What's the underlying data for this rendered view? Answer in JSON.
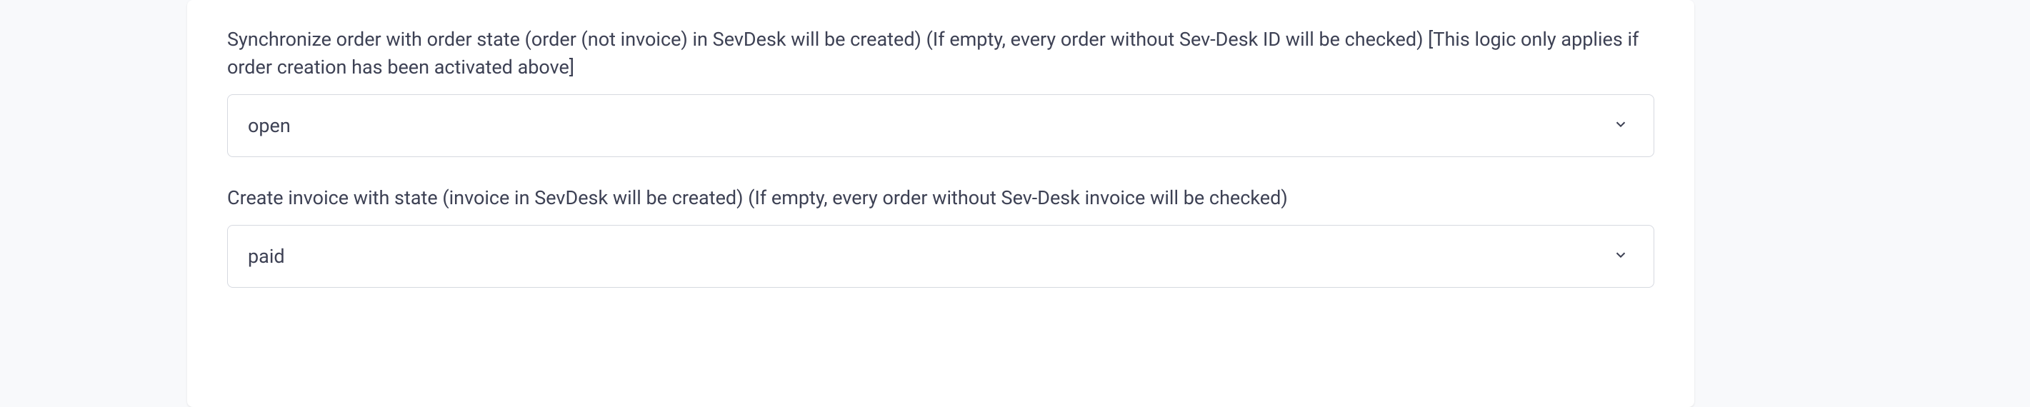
{
  "form": {
    "fields": [
      {
        "label": "Synchronize order with order state (order (not invoice) in SevDesk will be created) (If empty, every order without Sev-Desk ID will be checked) [This logic only applies if order creation has been activated above]",
        "value": "open"
      },
      {
        "label": "Create invoice with state (invoice in SevDesk will be created) (If empty, every order without Sev-Desk invoice will be checked)",
        "value": "paid"
      }
    ]
  }
}
